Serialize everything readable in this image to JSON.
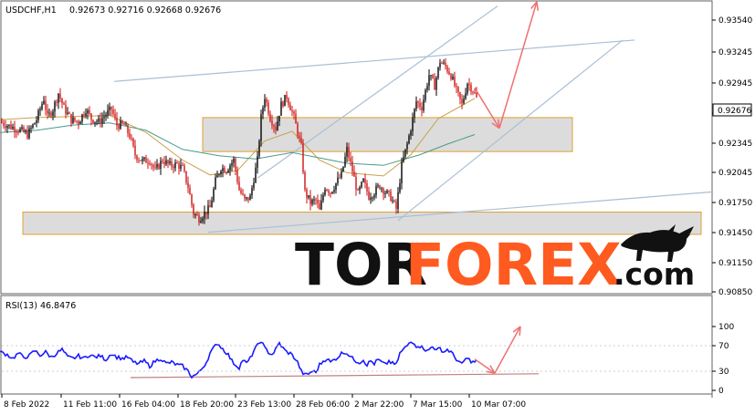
{
  "header": {
    "symbol_tf": "USDCHF,H1",
    "ohlc": "0.92673 0.92716 0.92668 0.92676"
  },
  "rsi_header": "RSI(13) 46.8476",
  "watermark": {
    "tor": "TOR",
    "forex": "FOREX",
    "com": ".com",
    "tor_color": "#111111",
    "forex_color": "#ff5a1f"
  },
  "chart_data": [
    {
      "type": "candlestick",
      "symbol": "USDCHF",
      "timeframe": "H1",
      "y_ticks": [
        "0.93540",
        "0.93245",
        "0.92945",
        "0.92645",
        "0.92345",
        "0.92045",
        "0.91750",
        "0.91450",
        "0.91150",
        "0.90850"
      ],
      "ylim": [
        0.9085,
        0.9359
      ],
      "x_ticks": [
        "8 Feb 2022",
        "11 Feb 11:00",
        "16 Feb 04:00",
        "18 Feb 20:00",
        "23 Feb 13:00",
        "28 Feb 06:00",
        "2 Mar 22:00",
        "7 Mar 15:00",
        "10 Mar 07:00"
      ],
      "current_price": "0.92676",
      "price_path": [
        [
          0,
          0.9246
        ],
        [
          10,
          0.9242
        ],
        [
          20,
          0.9239
        ],
        [
          30,
          0.9234
        ],
        [
          40,
          0.9248
        ],
        [
          48,
          0.9268
        ],
        [
          52,
          0.925
        ],
        [
          58,
          0.9258
        ],
        [
          64,
          0.9273
        ],
        [
          70,
          0.9259
        ],
        [
          78,
          0.9248
        ],
        [
          86,
          0.9246
        ],
        [
          94,
          0.9258
        ],
        [
          100,
          0.9249
        ],
        [
          108,
          0.9246
        ],
        [
          116,
          0.9253
        ],
        [
          122,
          0.9258
        ],
        [
          128,
          0.9243
        ],
        [
          136,
          0.9243
        ],
        [
          142,
          0.9233
        ],
        [
          148,
          0.9215
        ],
        [
          156,
          0.9209
        ],
        [
          164,
          0.921
        ],
        [
          170,
          0.92
        ],
        [
          178,
          0.921
        ],
        [
          186,
          0.9205
        ],
        [
          194,
          0.9206
        ],
        [
          200,
          0.9202
        ],
        [
          206,
          0.9185
        ],
        [
          212,
          0.916
        ],
        [
          218,
          0.9155
        ],
        [
          224,
          0.916
        ],
        [
          230,
          0.9165
        ],
        [
          236,
          0.919
        ],
        [
          242,
          0.9203
        ],
        [
          248,
          0.9201
        ],
        [
          256,
          0.921
        ],
        [
          262,
          0.9182
        ],
        [
          268,
          0.9172
        ],
        [
          274,
          0.9175
        ],
        [
          282,
          0.921
        ],
        [
          286,
          0.925
        ],
        [
          290,
          0.927
        ],
        [
          296,
          0.925
        ],
        [
          302,
          0.924
        ],
        [
          308,
          0.9262
        ],
        [
          314,
          0.927
        ],
        [
          322,
          0.925
        ],
        [
          330,
          0.9222
        ],
        [
          334,
          0.918
        ],
        [
          340,
          0.917
        ],
        [
          346,
          0.9172
        ],
        [
          350,
          0.9162
        ],
        [
          356,
          0.9185
        ],
        [
          362,
          0.918
        ],
        [
          368,
          0.9188
        ],
        [
          374,
          0.9196
        ],
        [
          380,
          0.922
        ],
        [
          386,
          0.92
        ],
        [
          392,
          0.9178
        ],
        [
          398,
          0.919
        ],
        [
          404,
          0.9176
        ],
        [
          410,
          0.918
        ],
        [
          416,
          0.9186
        ],
        [
          422,
          0.918
        ],
        [
          428,
          0.9175
        ],
        [
          434,
          0.9164
        ],
        [
          440,
          0.9205
        ],
        [
          446,
          0.9225
        ],
        [
          450,
          0.924
        ],
        [
          456,
          0.9265
        ],
        [
          462,
          0.926
        ],
        [
          470,
          0.929
        ],
        [
          476,
          0.928
        ],
        [
          482,
          0.9303
        ],
        [
          488,
          0.9298
        ],
        [
          494,
          0.929
        ],
        [
          500,
          0.9275
        ],
        [
          506,
          0.9262
        ],
        [
          512,
          0.9283
        ],
        [
          518,
          0.9276
        ],
        [
          522,
          0.9268
        ]
      ],
      "moving_averages": [
        {
          "color": "#c8a24a",
          "points": [
            [
              0,
              0.9248
            ],
            [
              40,
              0.925
            ],
            [
              80,
              0.9251
            ],
            [
              120,
              0.9252
            ],
            [
              160,
              0.9236
            ],
            [
              200,
              0.921
            ],
            [
              230,
              0.9196
            ],
            [
              260,
              0.92
            ],
            [
              290,
              0.9228
            ],
            [
              320,
              0.9237
            ],
            [
              350,
              0.921
            ],
            [
              380,
              0.9198
            ],
            [
              420,
              0.9195
            ],
            [
              450,
              0.9215
            ],
            [
              480,
              0.9249
            ],
            [
              520,
              0.9268
            ]
          ]
        },
        {
          "color": "#4a9a8c",
          "points": [
            [
              0,
              0.9236
            ],
            [
              40,
              0.9238
            ],
            [
              80,
              0.9243
            ],
            [
              120,
              0.9245
            ],
            [
              160,
              0.9238
            ],
            [
              200,
              0.922
            ],
            [
              240,
              0.9214
            ],
            [
              280,
              0.9211
            ],
            [
              320,
              0.9217
            ],
            [
              350,
              0.9212
            ],
            [
              380,
              0.9207
            ],
            [
              420,
              0.9205
            ],
            [
              460,
              0.9215
            ],
            [
              490,
              0.9225
            ],
            [
              520,
              0.9234
            ]
          ]
        }
      ],
      "zones": [
        {
          "x": [
            222,
            627
          ],
          "y": [
            0.925,
            0.9218
          ]
        },
        {
          "x": [
            25,
            768
          ],
          "y": [
            0.9161,
            0.914
          ]
        }
      ],
      "trend_lines": [
        {
          "from": [
            125,
            0.9284
          ],
          "to": [
            695,
            0.9323
          ],
          "color": "#a9bfd6"
        },
        {
          "from": [
            228,
            0.9142
          ],
          "to": [
            780,
            0.918
          ],
          "color": "#a9bfd6"
        },
        {
          "from": [
            282,
            0.9193
          ],
          "to": [
            545,
            0.9355
          ],
          "color": "#a9bfd6"
        },
        {
          "from": [
            436,
            0.9153
          ],
          "to": [
            682,
            0.9323
          ],
          "color": "#a9bfd6"
        }
      ],
      "forecast_arrows": [
        {
          "from": [
            520,
            0.9278
          ],
          "to": [
            547,
            0.924
          ],
          "color": "#f07070"
        },
        {
          "from": [
            547,
            0.924
          ],
          "to": [
            588,
            0.9359
          ],
          "color": "#f07070"
        }
      ]
    },
    {
      "type": "line",
      "indicator": "RSI(13)",
      "value": "46.8476",
      "y_ticks": [
        "100",
        "70",
        "30",
        "0"
      ],
      "ylim": [
        0,
        100
      ],
      "x_ticks": [
        "8 Feb 2022",
        "11 Feb 11:00",
        "16 Feb 04:00",
        "18 Feb 20:00",
        "23 Feb 13:00",
        "28 Feb 06:00",
        "2 Mar 22:00",
        "7 Mar 15:00",
        "10 Mar 07:00"
      ],
      "rsi_path": [
        [
          0,
          60
        ],
        [
          8,
          56
        ],
        [
          14,
          50
        ],
        [
          20,
          58
        ],
        [
          26,
          52
        ],
        [
          32,
          54
        ],
        [
          38,
          62
        ],
        [
          44,
          55
        ],
        [
          50,
          60
        ],
        [
          56,
          52
        ],
        [
          62,
          58
        ],
        [
          68,
          64
        ],
        [
          74,
          52
        ],
        [
          80,
          50
        ],
        [
          86,
          54
        ],
        [
          92,
          50
        ],
        [
          98,
          56
        ],
        [
          104,
          52
        ],
        [
          110,
          54
        ],
        [
          116,
          48
        ],
        [
          122,
          58
        ],
        [
          128,
          52
        ],
        [
          134,
          50
        ],
        [
          140,
          52
        ],
        [
          146,
          44
        ],
        [
          152,
          42
        ],
        [
          158,
          46
        ],
        [
          164,
          38
        ],
        [
          170,
          46
        ],
        [
          176,
          50
        ],
        [
          182,
          42
        ],
        [
          188,
          44
        ],
        [
          194,
          40
        ],
        [
          200,
          38
        ],
        [
          206,
          30
        ],
        [
          210,
          22
        ],
        [
          214,
          24
        ],
        [
          218,
          28
        ],
        [
          222,
          36
        ],
        [
          226,
          44
        ],
        [
          230,
          58
        ],
        [
          234,
          66
        ],
        [
          238,
          74
        ],
        [
          242,
          68
        ],
        [
          246,
          62
        ],
        [
          250,
          56
        ],
        [
          254,
          46
        ],
        [
          258,
          40
        ],
        [
          262,
          36
        ],
        [
          266,
          48
        ],
        [
          270,
          42
        ],
        [
          274,
          50
        ],
        [
          278,
          62
        ],
        [
          282,
          70
        ],
        [
          286,
          78
        ],
        [
          290,
          66
        ],
        [
          294,
          60
        ],
        [
          298,
          56
        ],
        [
          302,
          64
        ],
        [
          306,
          74
        ],
        [
          310,
          66
        ],
        [
          314,
          60
        ],
        [
          318,
          58
        ],
        [
          322,
          52
        ],
        [
          326,
          44
        ],
        [
          330,
          30
        ],
        [
          334,
          24
        ],
        [
          338,
          26
        ],
        [
          342,
          30
        ],
        [
          346,
          28
        ],
        [
          350,
          40
        ],
        [
          354,
          46
        ],
        [
          358,
          50
        ],
        [
          362,
          44
        ],
        [
          366,
          48
        ],
        [
          370,
          52
        ],
        [
          374,
          58
        ],
        [
          378,
          60
        ],
        [
          382,
          56
        ],
        [
          386,
          50
        ],
        [
          390,
          46
        ],
        [
          394,
          44
        ],
        [
          398,
          48
        ],
        [
          402,
          40
        ],
        [
          406,
          46
        ],
        [
          410,
          42
        ],
        [
          414,
          48
        ],
        [
          418,
          44
        ],
        [
          422,
          40
        ],
        [
          426,
          46
        ],
        [
          430,
          42
        ],
        [
          434,
          40
        ],
        [
          438,
          58
        ],
        [
          442,
          64
        ],
        [
          446,
          70
        ],
        [
          450,
          78
        ],
        [
          454,
          74
        ],
        [
          458,
          66
        ],
        [
          462,
          72
        ],
        [
          466,
          60
        ],
        [
          470,
          64
        ],
        [
          474,
          70
        ],
        [
          478,
          62
        ],
        [
          482,
          66
        ],
        [
          486,
          60
        ],
        [
          490,
          64
        ],
        [
          494,
          60
        ],
        [
          498,
          52
        ],
        [
          502,
          46
        ],
        [
          506,
          40
        ],
        [
          510,
          50
        ],
        [
          514,
          48
        ],
        [
          518,
          44
        ],
        [
          522,
          46
        ]
      ],
      "trend_line": {
        "from": [
          143,
          20
        ],
        "to": [
          590,
          26
        ],
        "color": "#c08080"
      },
      "forecast_arrows": [
        {
          "from": [
            520,
            49
          ],
          "to": [
            542,
            27
          ],
          "color": "#f07070"
        },
        {
          "from": [
            542,
            27
          ],
          "to": [
            570,
            100
          ],
          "color": "#f07070"
        }
      ]
    }
  ]
}
